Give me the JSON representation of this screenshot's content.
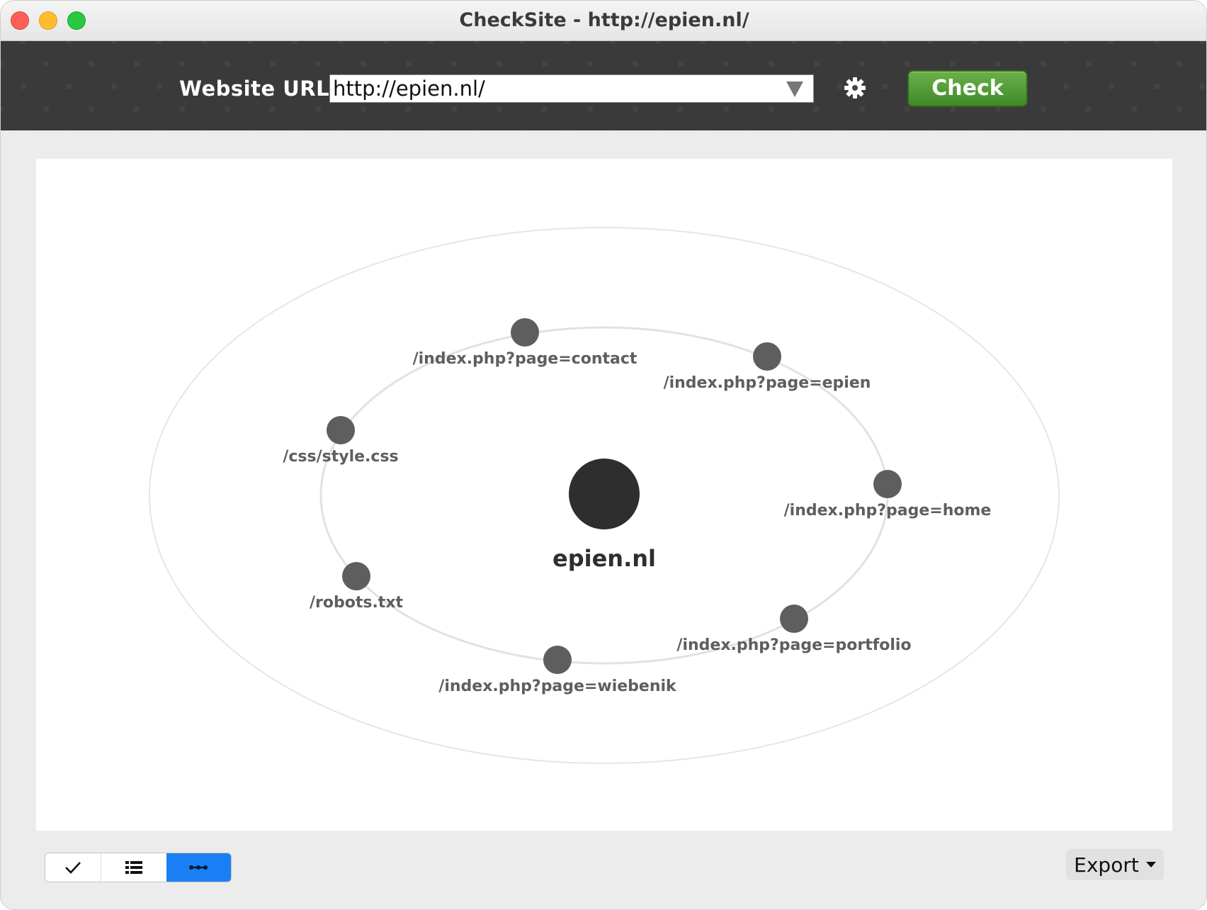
{
  "window": {
    "title": "CheckSite - http://epien.nl/"
  },
  "toolbar": {
    "url_label": "Website URL:",
    "url_value": "http://epien.nl/",
    "check_label": "Check"
  },
  "graph": {
    "root": "epien.nl",
    "nodes": [
      "/index.php?page=contact",
      "/index.php?page=epien",
      "/css/style.css",
      "/index.php?page=home",
      "/robots.txt",
      "/index.php?page=portfolio",
      "/index.php?page=wiebenik"
    ]
  },
  "bottom": {
    "views": [
      "checklist-icon",
      "list-icon",
      "graph-icon"
    ],
    "active_view": "graph-icon",
    "export_label": "Export"
  },
  "colors": {
    "check_button": "#4a9a30",
    "active_segment": "#1a7ff5",
    "node": "#5e5e5e",
    "root_node": "#2e2e2e"
  }
}
